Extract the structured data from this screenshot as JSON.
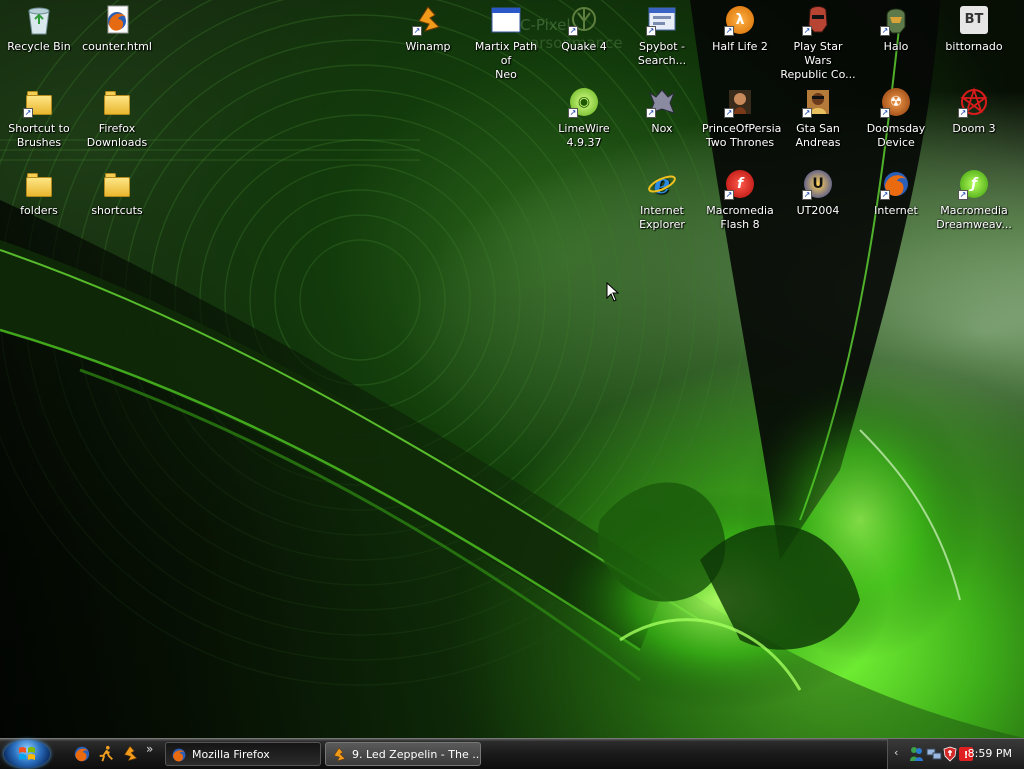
{
  "desktop": {
    "icons": [
      {
        "id": "recycle-bin",
        "label": "Recycle Bin",
        "icon": "recycle-bin-icon",
        "shortcut": false
      },
      {
        "id": "counter-html",
        "label": "counter.html",
        "icon": "firefox-document-icon",
        "shortcut": false
      },
      {
        "id": "shortcut-brushes",
        "label": "Shortcut to\nBrushes",
        "icon": "folder-icon",
        "shortcut": true
      },
      {
        "id": "firefox-downloads",
        "label": "Firefox\nDownloads",
        "icon": "folder-icon",
        "shortcut": false
      },
      {
        "id": "folders",
        "label": "folders",
        "icon": "folder-icon",
        "shortcut": false
      },
      {
        "id": "shortcuts",
        "label": "shortcuts",
        "icon": "folder-icon",
        "shortcut": false
      },
      {
        "id": "winamp",
        "label": "Winamp",
        "icon": "winamp-icon",
        "shortcut": true
      },
      {
        "id": "matrix",
        "label": "Martix Path of\nNeo",
        "icon": "application-window-icon",
        "shortcut": false
      },
      {
        "id": "quake4",
        "label": "Quake 4",
        "icon": "quake-icon",
        "shortcut": true
      },
      {
        "id": "spybot",
        "label": "Spybot -\nSearch...",
        "icon": "spybot-icon",
        "shortcut": true
      },
      {
        "id": "halflife2",
        "label": "Half Life 2",
        "icon": "half-life-icon",
        "shortcut": true
      },
      {
        "id": "starwars",
        "label": "Play Star Wars\nRepublic Co...",
        "icon": "clone-trooper-icon",
        "shortcut": true
      },
      {
        "id": "halo",
        "label": "Halo",
        "icon": "halo-helmet-icon",
        "shortcut": true
      },
      {
        "id": "bittornado",
        "label": "bittornado",
        "icon": "bittornado-icon",
        "shortcut": false
      },
      {
        "id": "limewire",
        "label": "LimeWire\n4.9.37",
        "icon": "limewire-icon",
        "shortcut": true
      },
      {
        "id": "nox",
        "label": "Nox",
        "icon": "nox-icon",
        "shortcut": true
      },
      {
        "id": "princeofpersia",
        "label": "PrinceOfPersia\nTwo Thrones",
        "icon": "prince-of-persia-icon",
        "shortcut": true
      },
      {
        "id": "gta",
        "label": "Gta San\nAndreas",
        "icon": "gta-icon",
        "shortcut": true
      },
      {
        "id": "doomsday",
        "label": "Doomsday\nDevice",
        "icon": "doomsday-icon",
        "shortcut": true
      },
      {
        "id": "doom3",
        "label": "Doom 3",
        "icon": "pentagram-icon",
        "shortcut": true
      },
      {
        "id": "ie",
        "label": "Internet\nExplorer",
        "icon": "internet-explorer-icon",
        "shortcut": false
      },
      {
        "id": "flash8",
        "label": "Macromedia\nFlash 8",
        "icon": "flash-icon",
        "shortcut": true
      },
      {
        "id": "ut2004",
        "label": "UT2004",
        "icon": "unreal-tournament-icon",
        "shortcut": true
      },
      {
        "id": "internet",
        "label": "Internet",
        "icon": "firefox-icon",
        "shortcut": true
      },
      {
        "id": "dreamweaver",
        "label": "Macromedia\nDreamweav...",
        "icon": "dreamweaver-icon",
        "shortcut": true
      }
    ]
  },
  "taskbar": {
    "start_icon": "windows-logo-icon",
    "quick_launch": [
      "firefox-icon",
      "winamp-runner-icon",
      "winamp-icon"
    ],
    "quick_launch_more": "»",
    "tasks": [
      {
        "label": "Mozilla Firefox",
        "icon": "firefox-icon",
        "active": true
      },
      {
        "label": "9. Led Zeppelin - The ...",
        "icon": "winamp-icon",
        "active": false
      }
    ],
    "tray": {
      "chevron": "‹",
      "icons": [
        "messenger-icon",
        "network-icon",
        "shield-icon",
        "alert-icon"
      ],
      "clock": "8:59 PM"
    }
  },
  "colors": {
    "accent_green": "#5ee02a",
    "taskbar_dark": "#1a1a1a",
    "label_text": "#ffffff"
  }
}
